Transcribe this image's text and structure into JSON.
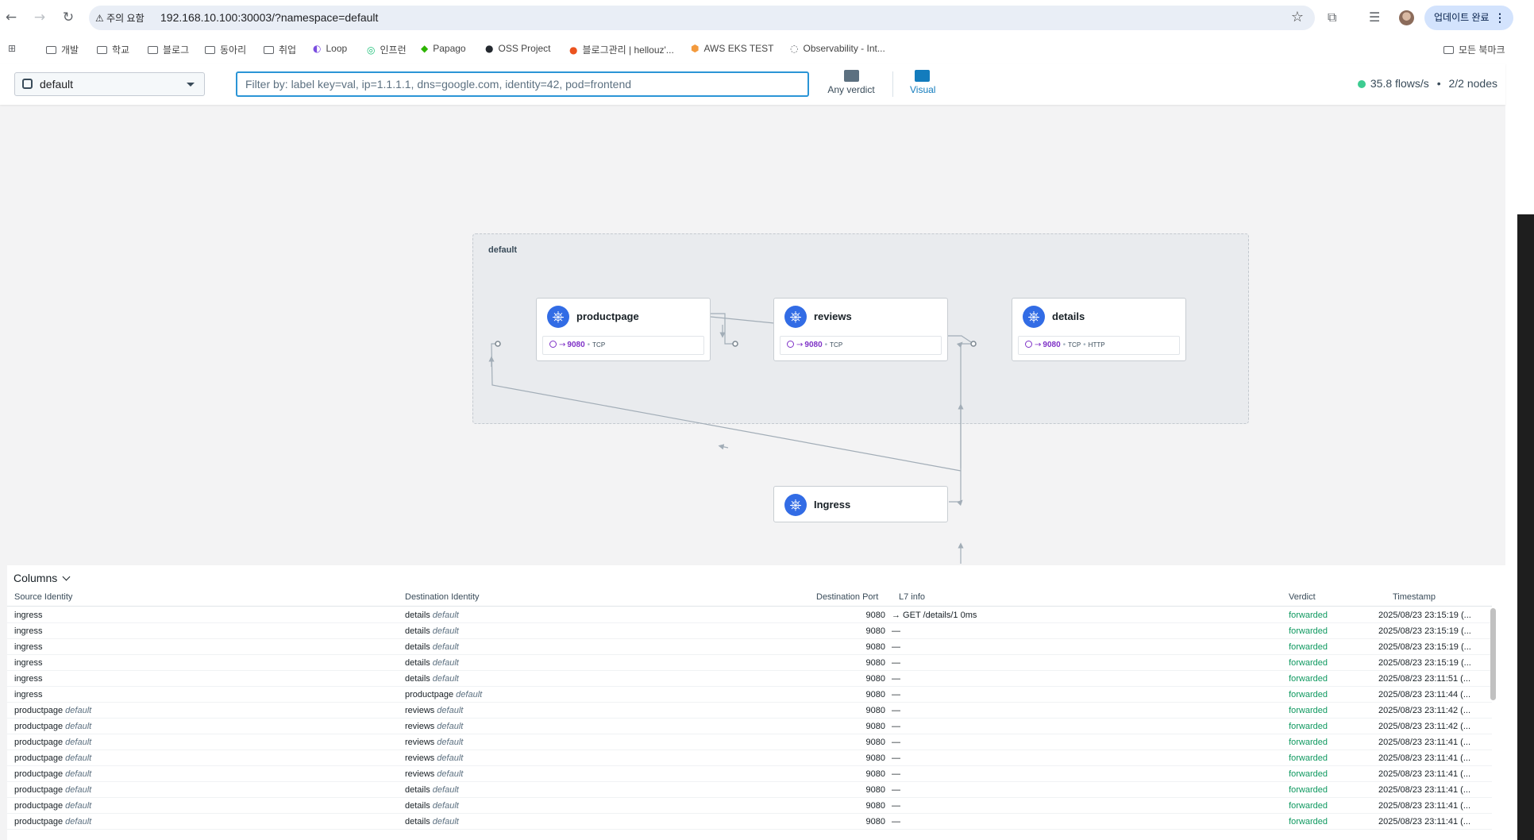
{
  "browser": {
    "security_label": "주의 요함",
    "url": "192.168.10.100:30003/?namespace=default",
    "update_label": "업데이트 완료",
    "bookmarks": [
      {
        "label": "개발",
        "icon": "folder-icon"
      },
      {
        "label": "학교",
        "icon": "folder-icon"
      },
      {
        "label": "블로그",
        "icon": "folder-icon"
      },
      {
        "label": "동아리",
        "icon": "folder-icon"
      },
      {
        "label": "취업",
        "icon": "folder-icon"
      },
      {
        "label": "Loop",
        "icon": "loop-icon"
      },
      {
        "label": "인프런",
        "icon": "inflearn-icon"
      },
      {
        "label": "Papago",
        "icon": "papago-icon"
      },
      {
        "label": "OSS Project",
        "icon": "github-icon"
      },
      {
        "label": "블로그관리 | hellouz'...",
        "icon": "tistory-icon"
      },
      {
        "label": "AWS EKS TEST",
        "icon": "aws-icon"
      },
      {
        "label": "Observability - Int...",
        "icon": "page-icon"
      }
    ],
    "all_bookmarks_label": "모든 북마크"
  },
  "header": {
    "namespace": "default",
    "filter_placeholder": "Filter by: label key=val, ip=1.1.1.1, dns=google.com, identity=42, pod=frontend",
    "verdict_label": "Any verdict",
    "visual_label": "Visual",
    "flow_rate": "35.8 flows/s",
    "separator": "•",
    "nodes": "2/2 nodes"
  },
  "service_map": {
    "namespace_label": "default",
    "services": [
      {
        "name": "productpage",
        "port": "9080",
        "protocols": [
          "TCP"
        ]
      },
      {
        "name": "reviews",
        "port": "9080",
        "protocols": [
          "TCP"
        ]
      },
      {
        "name": "details",
        "port": "9080",
        "protocols": [
          "TCP",
          "HTTP"
        ]
      },
      {
        "name": "Ingress"
      }
    ]
  },
  "flows": {
    "columns_label": "Columns",
    "headers": {
      "source": "Source Identity",
      "destination": "Destination Identity",
      "port": "Destination Port",
      "l7": "L7 info",
      "verdict": "Verdict",
      "timestamp": "Timestamp"
    },
    "rows": [
      {
        "src": "ingress",
        "src_ns": "",
        "dst": "details",
        "dst_ns": "default",
        "port": "9080",
        "l7": "→ GET  /details/1  0ms",
        "verdict": "forwarded",
        "ts": "2025/08/23 23:15:19 (..."
      },
      {
        "src": "ingress",
        "src_ns": "",
        "dst": "details",
        "dst_ns": "default",
        "port": "9080",
        "l7": "—",
        "verdict": "forwarded",
        "ts": "2025/08/23 23:15:19 (..."
      },
      {
        "src": "ingress",
        "src_ns": "",
        "dst": "details",
        "dst_ns": "default",
        "port": "9080",
        "l7": "—",
        "verdict": "forwarded",
        "ts": "2025/08/23 23:15:19 (..."
      },
      {
        "src": "ingress",
        "src_ns": "",
        "dst": "details",
        "dst_ns": "default",
        "port": "9080",
        "l7": "—",
        "verdict": "forwarded",
        "ts": "2025/08/23 23:15:19 (..."
      },
      {
        "src": "ingress",
        "src_ns": "",
        "dst": "details",
        "dst_ns": "default",
        "port": "9080",
        "l7": "—",
        "verdict": "forwarded",
        "ts": "2025/08/23 23:11:51 (..."
      },
      {
        "src": "ingress",
        "src_ns": "",
        "dst": "productpage",
        "dst_ns": "default",
        "port": "9080",
        "l7": "—",
        "verdict": "forwarded",
        "ts": "2025/08/23 23:11:44 (..."
      },
      {
        "src": "productpage",
        "src_ns": "default",
        "dst": "reviews",
        "dst_ns": "default",
        "port": "9080",
        "l7": "—",
        "verdict": "forwarded",
        "ts": "2025/08/23 23:11:42 (..."
      },
      {
        "src": "productpage",
        "src_ns": "default",
        "dst": "reviews",
        "dst_ns": "default",
        "port": "9080",
        "l7": "—",
        "verdict": "forwarded",
        "ts": "2025/08/23 23:11:42 (..."
      },
      {
        "src": "productpage",
        "src_ns": "default",
        "dst": "reviews",
        "dst_ns": "default",
        "port": "9080",
        "l7": "—",
        "verdict": "forwarded",
        "ts": "2025/08/23 23:11:41 (..."
      },
      {
        "src": "productpage",
        "src_ns": "default",
        "dst": "reviews",
        "dst_ns": "default",
        "port": "9080",
        "l7": "—",
        "verdict": "forwarded",
        "ts": "2025/08/23 23:11:41 (..."
      },
      {
        "src": "productpage",
        "src_ns": "default",
        "dst": "reviews",
        "dst_ns": "default",
        "port": "9080",
        "l7": "—",
        "verdict": "forwarded",
        "ts": "2025/08/23 23:11:41 (..."
      },
      {
        "src": "productpage",
        "src_ns": "default",
        "dst": "details",
        "dst_ns": "default",
        "port": "9080",
        "l7": "—",
        "verdict": "forwarded",
        "ts": "2025/08/23 23:11:41 (..."
      },
      {
        "src": "productpage",
        "src_ns": "default",
        "dst": "details",
        "dst_ns": "default",
        "port": "9080",
        "l7": "—",
        "verdict": "forwarded",
        "ts": "2025/08/23 23:11:41 (..."
      },
      {
        "src": "productpage",
        "src_ns": "default",
        "dst": "details",
        "dst_ns": "default",
        "port": "9080",
        "l7": "—",
        "verdict": "forwarded",
        "ts": "2025/08/23 23:11:41 (..."
      }
    ]
  },
  "colors": {
    "accent": "#137cbd",
    "forwarded": "#0f9960",
    "k8s": "#326ce5",
    "port": "#7f32c7"
  }
}
